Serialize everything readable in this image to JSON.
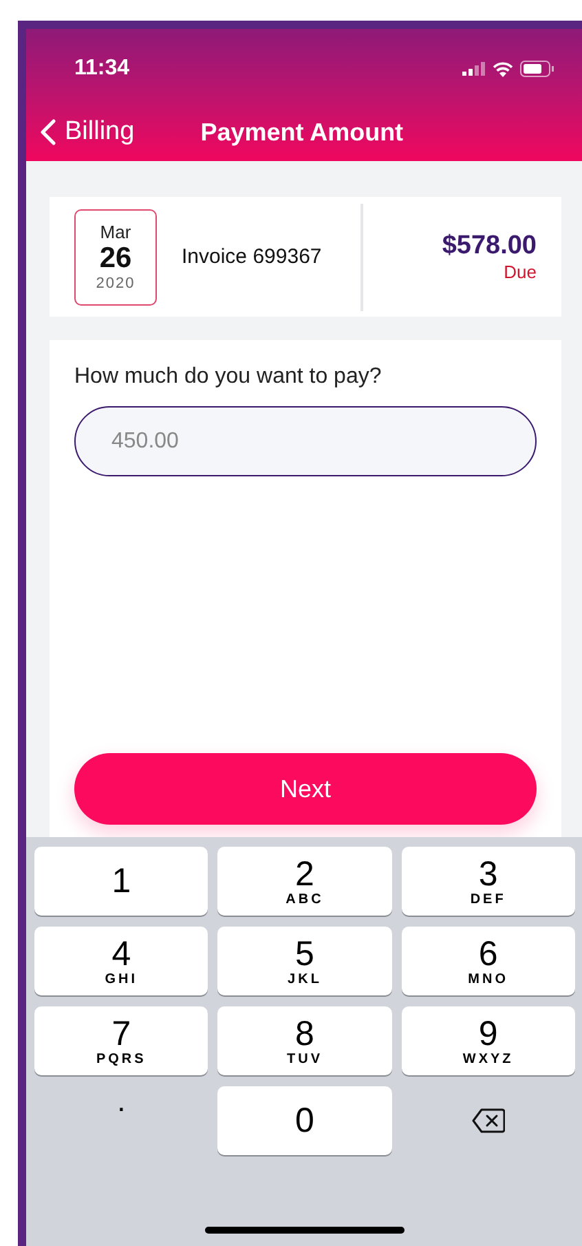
{
  "status_bar": {
    "time": "11:34"
  },
  "nav": {
    "back_label": "Billing",
    "title": "Payment Amount"
  },
  "invoice": {
    "month": "Mar",
    "day": "26",
    "year": "2020",
    "label": "Invoice 699367",
    "amount": "$578.00",
    "amount_status": "Due"
  },
  "payment": {
    "question": "How much do you want to pay?",
    "placeholder": "450.00",
    "button": "Next"
  },
  "keypad": [
    {
      "kind": "digit",
      "digit": "1"
    },
    {
      "kind": "digit",
      "digit": "2",
      "letters": "ABC"
    },
    {
      "kind": "digit",
      "digit": "3",
      "letters": "DEF"
    },
    {
      "kind": "digit",
      "digit": "4",
      "letters": "GHI"
    },
    {
      "kind": "digit",
      "digit": "5",
      "letters": "JKL"
    },
    {
      "kind": "digit",
      "digit": "6",
      "letters": "MNO"
    },
    {
      "kind": "digit",
      "digit": "7",
      "letters": "PQRS"
    },
    {
      "kind": "digit",
      "digit": "8",
      "letters": "TUV"
    },
    {
      "kind": "digit",
      "digit": "9",
      "letters": "WXYZ"
    },
    {
      "kind": "dot",
      "digit": "."
    },
    {
      "kind": "digit",
      "digit": "0"
    },
    {
      "kind": "delete"
    }
  ]
}
